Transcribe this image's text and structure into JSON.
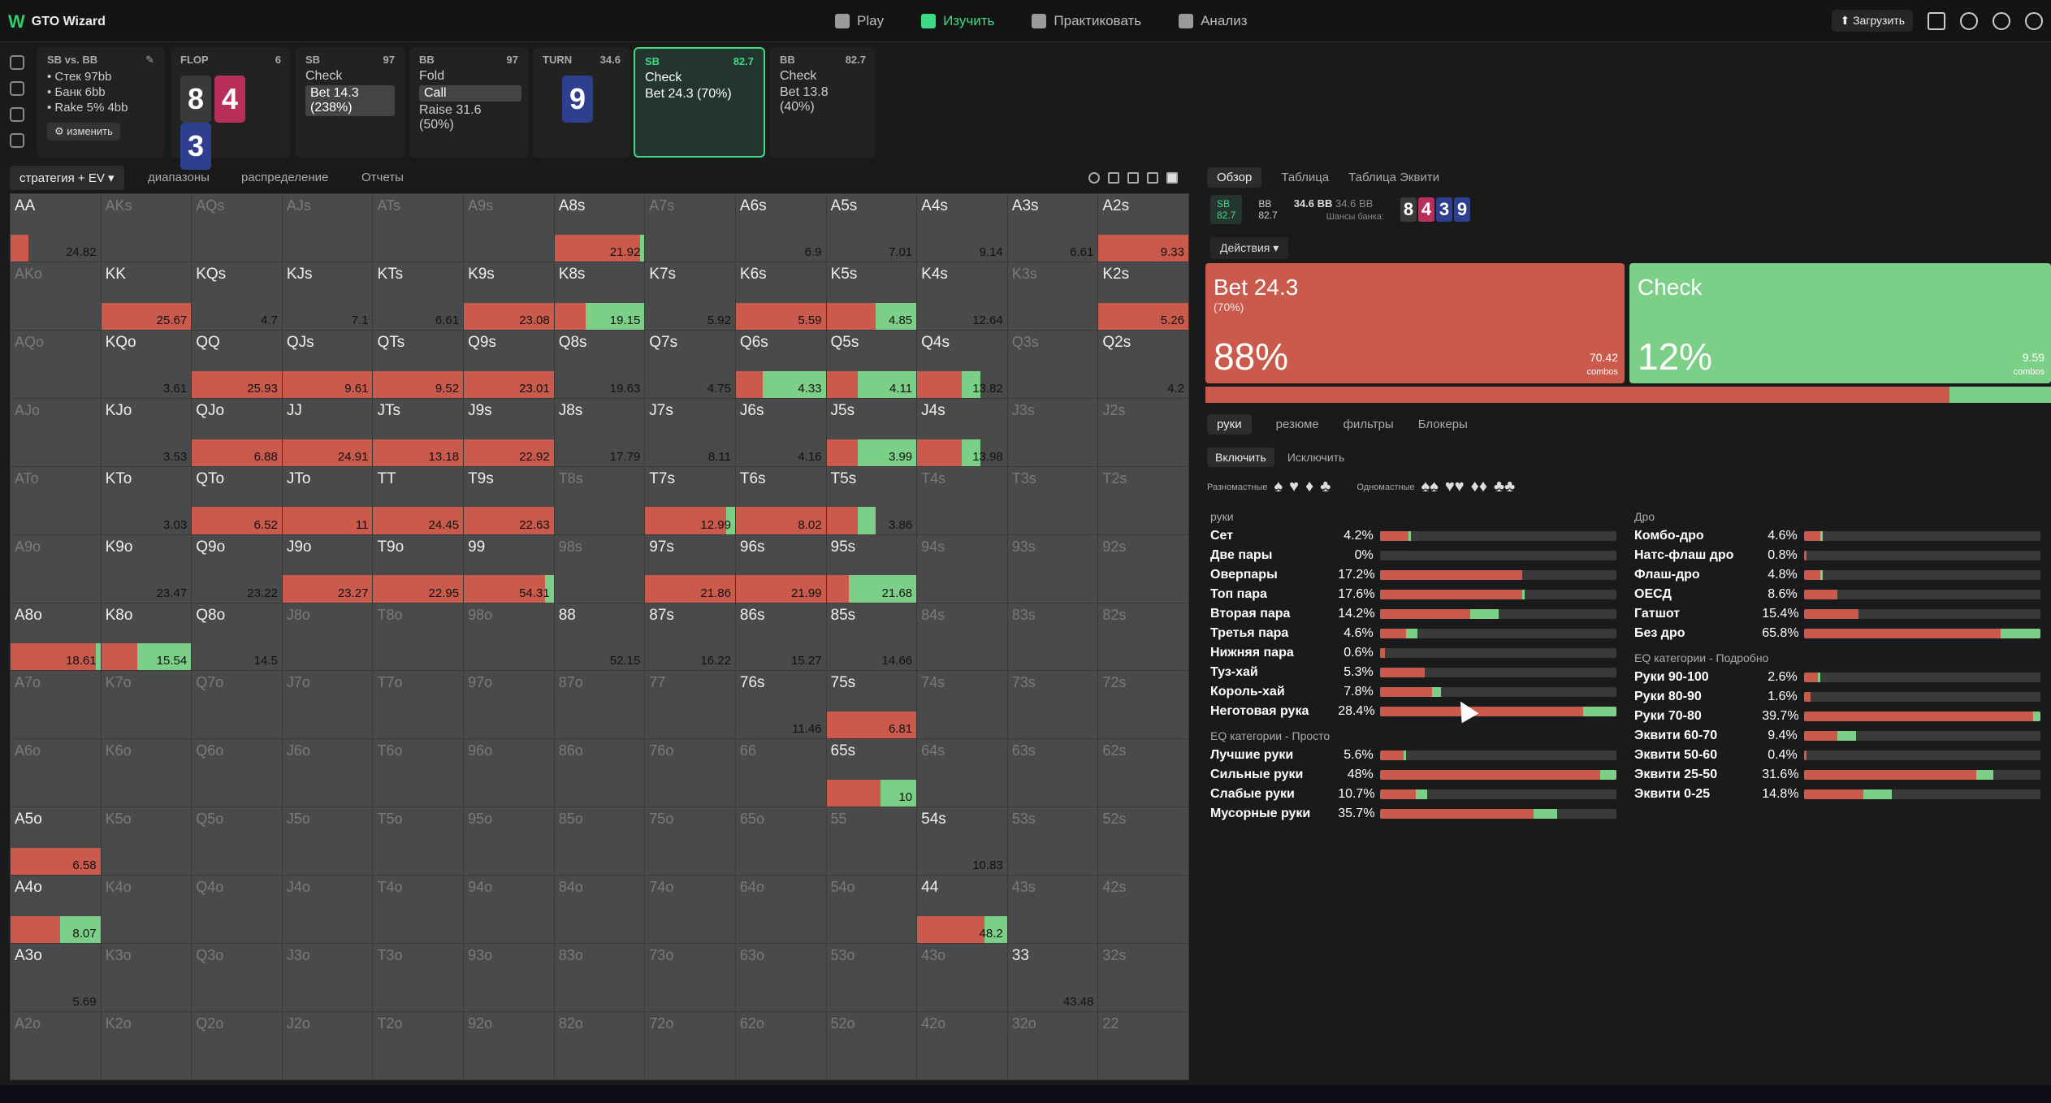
{
  "app": {
    "title": "GTO Wizard"
  },
  "nav": [
    {
      "label": "Play",
      "active": false
    },
    {
      "label": "Изучить",
      "active": true
    },
    {
      "label": "Практиковать",
      "active": false
    },
    {
      "label": "Анализ",
      "active": false
    }
  ],
  "upload_label": "Загрузить",
  "situation": {
    "title": "SB vs. BB",
    "stack": "Стек 97bb",
    "pot": "Банк 6bb",
    "rake": "Rake 5% 4bb",
    "change_label": "изменить"
  },
  "cards": [
    {
      "pos": "FLOP",
      "num": "6"
    },
    {
      "pos": "SB",
      "num": "97",
      "l1": "Check",
      "l2": "Bet 14.3 (238%)"
    },
    {
      "pos": "BB",
      "num": "97",
      "l1": "Fold",
      "l2": "Call",
      "l3": "Raise 31.6 (50%)"
    },
    {
      "pos": "TURN",
      "num": "34.6"
    },
    {
      "pos": "SB",
      "num": "82.7",
      "l1": "Check",
      "l2": "Bet 24.3 (70%)"
    },
    {
      "pos": "BB",
      "num": "82.7",
      "l1": "Check",
      "l2": "Bet 13.8 (40%)"
    }
  ],
  "board_flop": [
    {
      "rank": "8",
      "suit": "spades"
    },
    {
      "rank": "4",
      "suit": "hearts"
    },
    {
      "rank": "3",
      "suit": "clubs"
    }
  ],
  "board_turn": {
    "rank": "9",
    "suit": "clubs"
  },
  "left_tabs": [
    "стратегия + EV",
    "диапазоны",
    "распределение",
    "Отчеты"
  ],
  "grid": [
    [
      "AA|24.82|20|0",
      "AKs||0|0",
      "AQs||0|0",
      "AJs||0|0",
      "ATs||0|0",
      "A9s||0|0",
      "A8s|21.92|95|5",
      "A7s||0|0",
      "A6s|6.9|0|0",
      "A5s|7.01|0|0",
      "A4s|9.14|0|0",
      "A3s|6.61|0|0",
      "A2s|9.33|100|0"
    ],
    [
      "AKo||0|0",
      "KK|25.67|100|0",
      "KQs|4.7|0|0",
      "KJs|7.1|0|0",
      "KTs|6.61|0|0",
      "K9s|23.08|100|0",
      "K8s|19.15|35|65",
      "K7s|5.92|0|0",
      "K6s|5.59|100|0",
      "K5s|4.85|55|45",
      "K4s|12.64|0|0",
      "K3s||0|0",
      "K2s|5.26|100|0"
    ],
    [
      "AQo||0|0",
      "KQo|3.61|0|0",
      "QQ|25.93|100|0",
      "QJs|9.61|100|0",
      "QTs|9.52|100|0",
      "Q9s|23.01|100|0",
      "Q8s|19.63|0|0",
      "Q7s|4.75|0|0",
      "Q6s|4.33|30|70",
      "Q5s|4.11|35|65",
      "Q4s|13.82|50|20",
      "Q3s||0|0",
      "Q2s|4.2|0|0"
    ],
    [
      "AJo||0|0",
      "KJo|3.53|0|0",
      "QJo|6.88|100|0",
      "JJ|24.91|100|0",
      "JTs|13.18|100|0",
      "J9s|22.92|100|0",
      "J8s|17.79|0|0",
      "J7s|8.11|0|0",
      "J6s|4.16|0|0",
      "J5s|3.99|35|65",
      "J4s|13.98|50|20",
      "J3s||0|0",
      "J2s||0|0"
    ],
    [
      "ATo||0|0",
      "KTo|3.03|0|0",
      "QTo|6.52|100|0",
      "JTo|11|100|0",
      "TT|24.45|100|0",
      "T9s|22.63|100|0",
      "T8s||0|0",
      "T7s|12.99|90|10",
      "T6s|8.02|100|0",
      "T5s|3.86|35|20",
      "T4s||0|0",
      "T3s||0|0",
      "T2s||0|0"
    ],
    [
      "A9o||0|0",
      "K9o|23.47|0|0",
      "Q9o|23.22|0|0",
      "J9o|23.27|100|0",
      "T9o|22.95|100|0",
      "99|54.31|90|10",
      "98s||0|0",
      "97s|21.86|100|0",
      "96s|21.99|100|0",
      "95s|21.68|25|75",
      "94s||0|0",
      "93s||0|0",
      "92s||0|0"
    ],
    [
      "A8o|18.61|95|5",
      "K8o|15.54|40|60",
      "Q8o|14.5|0|0",
      "J8o||0|0",
      "T8o||0|0",
      "98o||0|0",
      "88|52.15|0|0",
      "87s|16.22|0|0",
      "86s|15.27|0|0",
      "85s|14.66|0|0",
      "84s||0|0",
      "83s||0|0",
      "82s||0|0"
    ],
    [
      "A7o||0|0",
      "K7o||0|0",
      "Q7o||0|0",
      "J7o||0|0",
      "T7o||0|0",
      "97o||0|0",
      "87o||0|0",
      "77||0|0",
      "76s|11.46|0|0",
      "75s|6.81|100|0",
      "74s||0|0",
      "73s||0|0",
      "72s||0|0"
    ],
    [
      "A6o||0|0",
      "K6o||0|0",
      "Q6o||0|0",
      "J6o||0|0",
      "T6o||0|0",
      "96o||0|0",
      "86o||0|0",
      "76o||0|0",
      "66||0|0",
      "65s|10|60|40",
      "64s||0|0",
      "63s||0|0",
      "62s||0|0"
    ],
    [
      "A5o|6.58|100|0",
      "K5o||0|0",
      "Q5o||0|0",
      "J5o||0|0",
      "T5o||0|0",
      "95o||0|0",
      "85o||0|0",
      "75o||0|0",
      "65o||0|0",
      "55||0|0",
      "54s|10.83|0|0",
      "53s||0|0",
      "52s||0|0"
    ],
    [
      "A4o|8.07|55|45",
      "K4o||0|0",
      "Q4o||0|0",
      "J4o||0|0",
      "T4o||0|0",
      "94o||0|0",
      "84o||0|0",
      "74o||0|0",
      "64o||0|0",
      "54o||0|0",
      "44|48.2|75|25",
      "43s||0|0",
      "42s||0|0"
    ],
    [
      "A3o|5.69|0|0",
      "K3o||0|0",
      "Q3o||0|0",
      "J3o||0|0",
      "T3o||0|0",
      "93o||0|0",
      "83o||0|0",
      "73o||0|0",
      "63o||0|0",
      "53o||0|0",
      "43o||0|0",
      "33|43.48|0|0",
      "32s||0|0"
    ],
    [
      "A2o||0|0",
      "K2o||0|0",
      "Q2o||0|0",
      "J2o||0|0",
      "T2o||0|0",
      "92o||0|0",
      "82o||0|0",
      "72o||0|0",
      "62o||0|0",
      "52o||0|0",
      "42o||0|0",
      "32o||0|0",
      "22||0|0"
    ]
  ],
  "right_tabs": [
    "Обзор",
    "Таблица",
    "Таблица Эквити"
  ],
  "potline": {
    "sb": "SB",
    "sb_v": "82.7",
    "bb": "BB",
    "bb_v": "82.7",
    "pot": "34.6 BB",
    "pot2": "34.6 BB",
    "potlbl": "Шансы банка:"
  },
  "actions_label": "Действия",
  "actions": [
    {
      "name": "Bet 24.3",
      "sub": "(70%)",
      "pct": "88%",
      "combos": "70.42",
      "unit": "combos",
      "color": "#c95a4c",
      "frac": 0.88
    },
    {
      "name": "Check",
      "sub": "",
      "pct": "12%",
      "combos": "9.59",
      "unit": "combos",
      "color": "#7bcf86",
      "frac": 0.12
    }
  ],
  "sub_tabs": [
    "руки",
    "резюме",
    "фильтры",
    "Блокеры"
  ],
  "include": [
    "Включить",
    "Исключить"
  ],
  "suit_labels": [
    "Разномастные",
    "Одномастные"
  ],
  "hands_title": "руки",
  "hands": [
    {
      "l": "Сет",
      "p": "4.2%",
      "r": 0.12,
      "g": 0.01
    },
    {
      "l": "Две пары",
      "p": "0%",
      "r": 0,
      "g": 0
    },
    {
      "l": "Оверпары",
      "p": "17.2%",
      "r": 0.6,
      "g": 0
    },
    {
      "l": "Топ пара",
      "p": "17.6%",
      "r": 0.6,
      "g": 0.01
    },
    {
      "l": "Вторая пара",
      "p": "14.2%",
      "r": 0.38,
      "g": 0.12
    },
    {
      "l": "Третья пара",
      "p": "4.6%",
      "r": 0.11,
      "g": 0.05
    },
    {
      "l": "Нижняя пара",
      "p": "0.6%",
      "r": 0.02,
      "g": 0
    },
    {
      "l": "Туз-хай",
      "p": "5.3%",
      "r": 0.19,
      "g": 0
    },
    {
      "l": "Король-хай",
      "p": "7.8%",
      "r": 0.22,
      "g": 0.04
    },
    {
      "l": "Неготовая рука",
      "p": "28.4%",
      "r": 0.86,
      "g": 0.14
    }
  ],
  "eq_simple_title": "EQ категории - Просто",
  "eq_simple": [
    {
      "l": "Лучшие руки",
      "p": "5.6%",
      "r": 0.1,
      "g": 0.01
    },
    {
      "l": "Сильные руки",
      "p": "48%",
      "r": 0.93,
      "g": 0.07
    },
    {
      "l": "Слабые руки",
      "p": "10.7%",
      "r": 0.15,
      "g": 0.05
    },
    {
      "l": "Мусорные руки",
      "p": "35.7%",
      "r": 0.65,
      "g": 0.1
    }
  ],
  "draws_title": "Дро",
  "draws": [
    {
      "l": "Комбо-дро",
      "p": "4.6%",
      "r": 0.07,
      "g": 0.01
    },
    {
      "l": "Натс-флаш дро",
      "p": "0.8%",
      "r": 0.01,
      "g": 0
    },
    {
      "l": "Флаш-дро",
      "p": "4.8%",
      "r": 0.07,
      "g": 0.01
    },
    {
      "l": "ОЕСД",
      "p": "8.6%",
      "r": 0.14,
      "g": 0
    },
    {
      "l": "Гатшот",
      "p": "15.4%",
      "r": 0.23,
      "g": 0
    },
    {
      "l": "Без дро",
      "p": "65.8%",
      "r": 0.83,
      "g": 0.17
    }
  ],
  "eq_detail_title": "EQ категории - Подробно",
  "eq_detail": [
    {
      "l": "Руки 90-100",
      "p": "2.6%",
      "r": 0.06,
      "g": 0.01
    },
    {
      "l": "Руки 80-90",
      "p": "1.6%",
      "r": 0.03,
      "g": 0
    },
    {
      "l": "Руки 70-80",
      "p": "39.7%",
      "r": 0.97,
      "g": 0.03
    },
    {
      "l": "Эквити 60-70",
      "p": "9.4%",
      "r": 0.14,
      "g": 0.08
    },
    {
      "l": "Эквити 50-60",
      "p": "0.4%",
      "r": 0.01,
      "g": 0
    },
    {
      "l": "Эквити 25-50",
      "p": "31.6%",
      "r": 0.73,
      "g": 0.07
    },
    {
      "l": "Эквити 0-25",
      "p": "14.8%",
      "r": 0.25,
      "g": 0.12
    }
  ]
}
